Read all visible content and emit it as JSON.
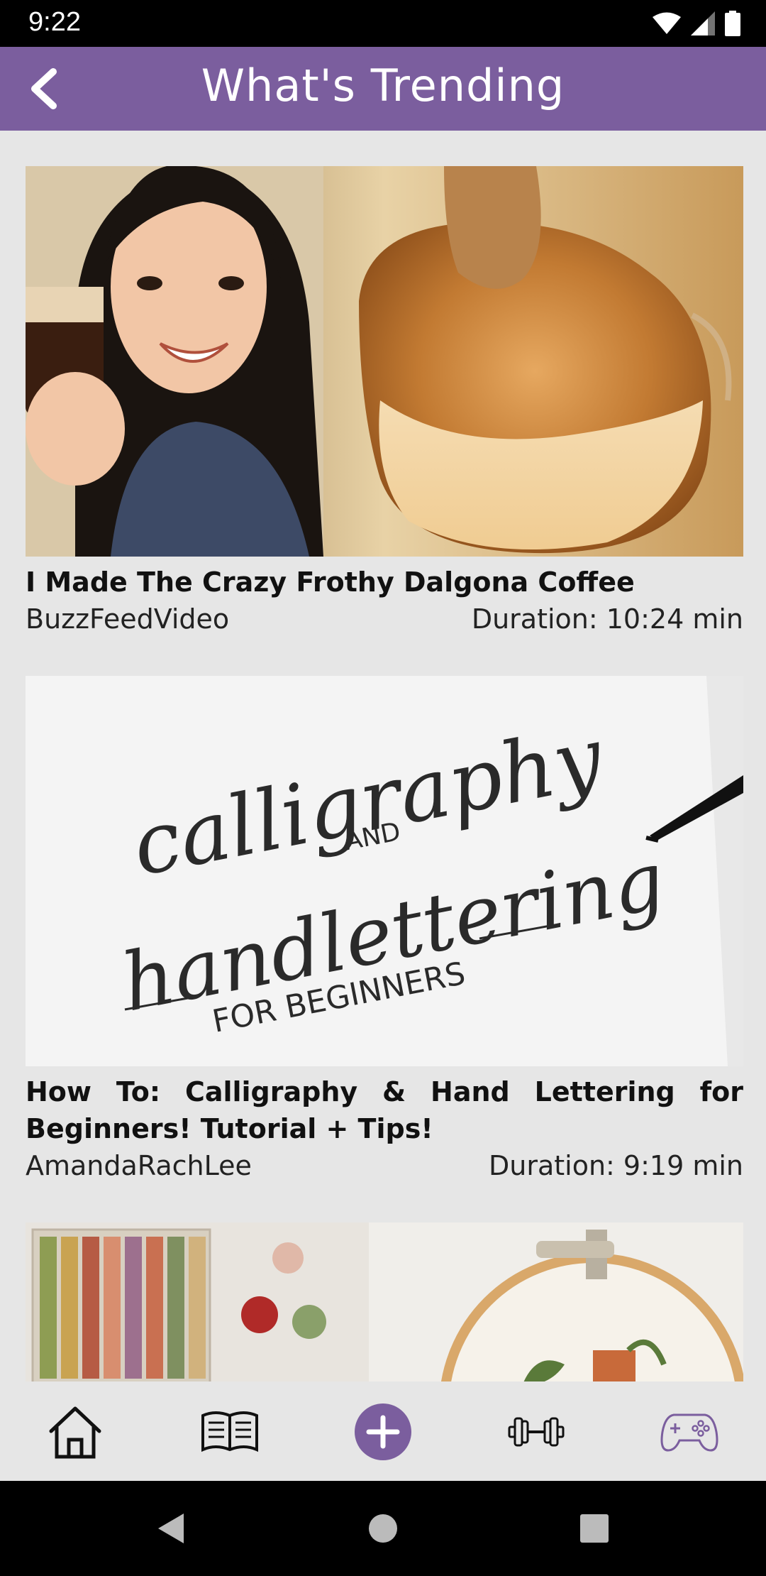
{
  "status": {
    "time": "9:22"
  },
  "header": {
    "title": "What's Trending"
  },
  "videos": [
    {
      "title": "I Made The Crazy Frothy Dalgona Coffee",
      "channel": "BuzzFeedVideo",
      "duration": "Duration: 10:24 min"
    },
    {
      "title": "How To: Calligraphy & Hand Lettering for Beginners! Tutorial + Tips!",
      "channel": "AmandaRachLee",
      "duration": "Duration: 9:19 min",
      "thumb_text": {
        "line1": "calligraphy",
        "and": "AND",
        "line2": "handlettering",
        "line3": "FOR BEGINNERS"
      }
    }
  ],
  "nav": {
    "items": [
      "home-icon",
      "book-icon",
      "add-icon",
      "dumbbell-icon",
      "gamepad-icon"
    ],
    "accent": "#7b5e9e"
  },
  "colors": {
    "app_bar": "#7b5e9e",
    "background": "#e6e6e6"
  }
}
